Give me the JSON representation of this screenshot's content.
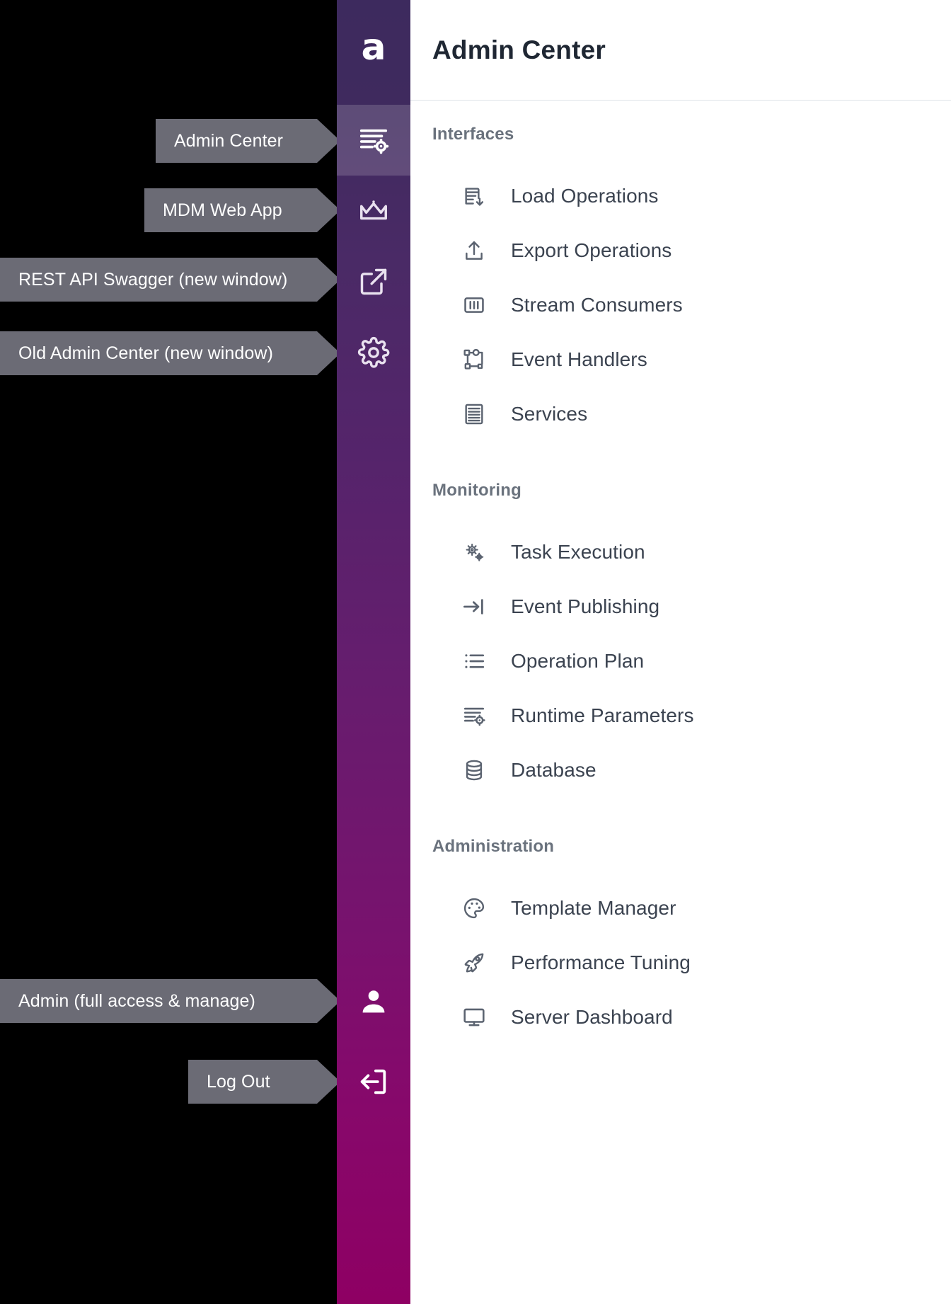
{
  "app": {
    "logo_glyph": "a",
    "logo_icon": "alto-logo-icon"
  },
  "header": {
    "title": "Admin Center"
  },
  "rail": {
    "items": [
      {
        "icon": "list-settings-icon",
        "name": "rail-admin-center",
        "active": true
      },
      {
        "icon": "crown-icon",
        "name": "rail-mdm-web-app",
        "active": false
      },
      {
        "icon": "external-link-icon",
        "name": "rail-rest-api-swagger",
        "active": false
      },
      {
        "icon": "gear-icon",
        "name": "rail-old-admin-center",
        "active": false
      },
      {
        "icon": "person-icon",
        "name": "rail-admin-user",
        "active": false
      },
      {
        "icon": "logout-icon",
        "name": "rail-log-out",
        "active": false
      }
    ]
  },
  "callouts": [
    {
      "label": "Admin Center",
      "target": "rail-admin-center"
    },
    {
      "label": "MDM Web App",
      "target": "rail-mdm-web-app"
    },
    {
      "label": "REST API Swagger (new window)",
      "target": "rail-rest-api-swagger"
    },
    {
      "label": "Old Admin Center (new window)",
      "target": "rail-old-admin-center"
    },
    {
      "label": "Admin  (full access & manage)",
      "target": "rail-admin-user"
    },
    {
      "label": "Log Out",
      "target": "rail-log-out"
    }
  ],
  "menu": {
    "sections": [
      {
        "title": "Interfaces",
        "items": [
          {
            "label": "Load Operations",
            "icon": "database-download-icon"
          },
          {
            "label": "Export Operations",
            "icon": "upload-icon"
          },
          {
            "label": "Stream Consumers",
            "icon": "columns-box-icon"
          },
          {
            "label": "Event Handlers",
            "icon": "event-flow-icon"
          },
          {
            "label": "Services",
            "icon": "server-icon"
          }
        ]
      },
      {
        "title": "Monitoring",
        "items": [
          {
            "label": "Task Execution",
            "icon": "gears-icon"
          },
          {
            "label": "Event Publishing",
            "icon": "arrow-to-bar-icon"
          },
          {
            "label": "Operation Plan",
            "icon": "bullet-list-icon"
          },
          {
            "label": "Runtime Parameters",
            "icon": "list-settings-icon"
          },
          {
            "label": "Database",
            "icon": "database-icon"
          }
        ]
      },
      {
        "title": "Administration",
        "items": [
          {
            "label": "Template Manager",
            "icon": "palette-icon"
          },
          {
            "label": "Performance Tuning",
            "icon": "rocket-icon"
          },
          {
            "label": "Server Dashboard",
            "icon": "monitor-icon"
          }
        ]
      }
    ]
  },
  "colors": {
    "rail_top": "#3d2a5e",
    "rail_bottom": "#8e0063",
    "rail_active": "#7a6292",
    "callout_bg": "#6b6b75",
    "panel_bg": "#ffffff",
    "section_title": "#6a727d",
    "item_text": "#3b4350",
    "backdrop": "#000000"
  }
}
